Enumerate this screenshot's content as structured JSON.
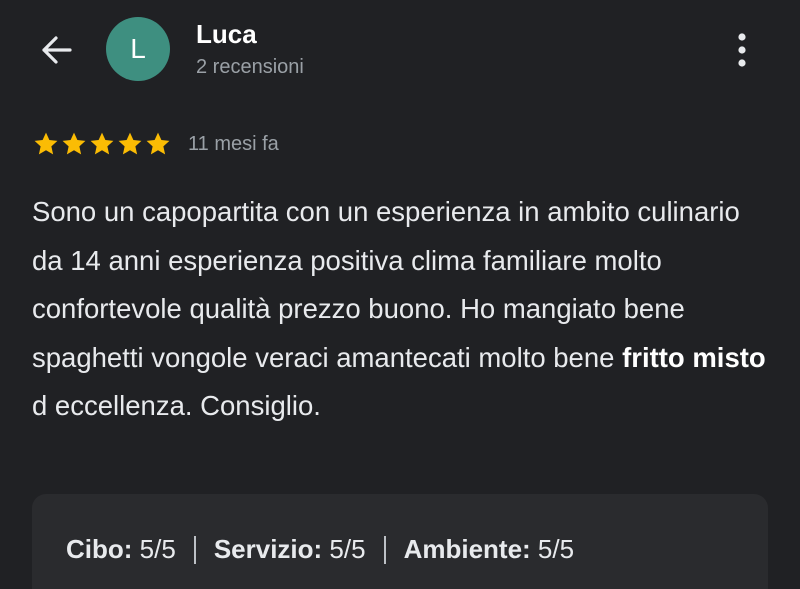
{
  "header": {
    "avatar_initial": "L",
    "user_name": "Luca",
    "review_count": "2 recensioni"
  },
  "review": {
    "stars": 5,
    "date": "11 mesi fa",
    "text_before_bold": "Sono un capopartita con un esperienza in ambito culinario da 14 anni esperienza positiva clima familiare molto confortevole qualità prezzo buono. Ho mangiato bene spaghetti vongole veraci amantecati molto bene ",
    "text_bold": "fritto misto",
    "text_after_bold": " d eccellenza. Consiglio."
  },
  "scores": [
    {
      "label": "Cibo:",
      "value": "5/5"
    },
    {
      "label": "Servizio:",
      "value": "5/5"
    },
    {
      "label": "Ambiente:",
      "value": "5/5"
    }
  ],
  "colors": {
    "background": "#202124",
    "avatar": "#3e8f80",
    "star": "#fbbc04",
    "card": "#2a2b2e"
  },
  "icons": {
    "back": "arrow-left-icon",
    "more": "more-vert-icon",
    "star": "star-icon"
  }
}
